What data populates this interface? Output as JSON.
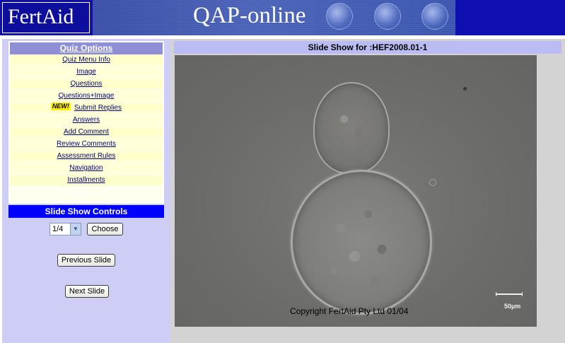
{
  "header": {
    "logo_text": "FertAid",
    "banner_title": "QAP-online"
  },
  "quiz_options": {
    "title": "Quiz Options",
    "items": [
      {
        "label": "Quiz Menu Info"
      },
      {
        "label": "Image"
      },
      {
        "label": "Questions"
      },
      {
        "label": "Questions+Image"
      },
      {
        "label": "Submit Replies",
        "badge": "NEW!"
      },
      {
        "label": "Answers"
      },
      {
        "label": "Add Comment"
      },
      {
        "label": "Review Comments"
      },
      {
        "label": "Assessment Rules"
      },
      {
        "label": "Navigation"
      },
      {
        "label": "Installments"
      }
    ]
  },
  "slide_show_controls": {
    "title": "Slide Show Controls",
    "slide_select_value": "1/4",
    "choose_label": "Choose",
    "previous_label": "Previous Slide",
    "next_label": "Next Slide"
  },
  "main": {
    "slide_title": "Slide Show for :HEF2008.01-1",
    "image": {
      "copyright": "Copyright FertAid Pty Ltd 01/04",
      "scale_label": "50µm"
    }
  },
  "colors": {
    "header_bg": "#1010a8",
    "quiz_header_bg": "#8f8fd8",
    "controls_header_bg": "#0000ff",
    "left_panel_bg": "#cdcdf6",
    "quiz_item_bg": "#ffffcc",
    "link_color": "#000080"
  },
  "icons": {
    "select_arrow": "chevron-down-icon"
  }
}
